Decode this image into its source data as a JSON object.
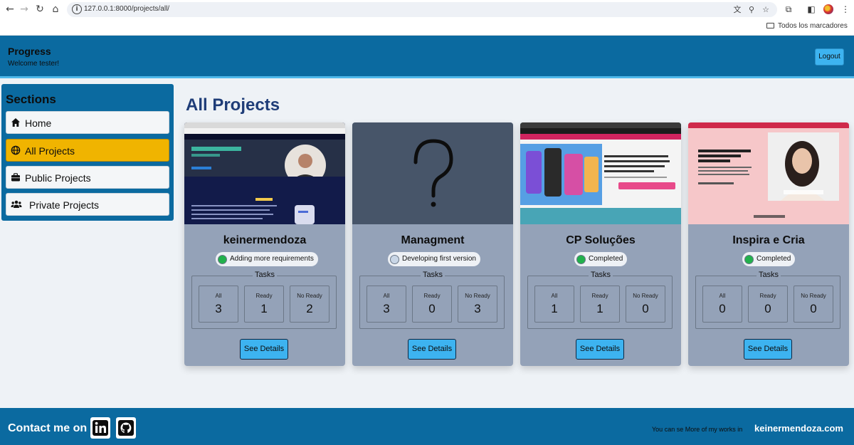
{
  "browser": {
    "url": "127.0.0.1:8000/projects/all/",
    "bookmarks_label": "Todos los marcadores"
  },
  "header": {
    "brand": "Progress",
    "welcome": "Welcome tester!",
    "logout_label": "Logout"
  },
  "sidebar": {
    "title": "Sections",
    "items": [
      {
        "label": "Home",
        "icon": "home-icon",
        "active": false
      },
      {
        "label": "All Projects",
        "icon": "globe-icon",
        "active": true
      },
      {
        "label": "Public Projects",
        "icon": "briefcase-icon",
        "active": false
      },
      {
        "label": "Private Projects",
        "icon": "users-icon",
        "active": false
      }
    ]
  },
  "main": {
    "title": "All Projects",
    "tasks_heading": "Tasks",
    "details_label": "See Details",
    "task_labels": [
      "All",
      "Ready",
      "No Ready"
    ],
    "projects": [
      {
        "name": "keinermendoza",
        "status": "Adding more requirements",
        "status_color": "#22b14c",
        "tasks": {
          "all": "3",
          "ready": "1",
          "no_ready": "2"
        }
      },
      {
        "name": "Managment",
        "status": "Developing first version",
        "status_color": "#c9d6e6",
        "tasks": {
          "all": "3",
          "ready": "0",
          "no_ready": "3"
        }
      },
      {
        "name": "CP Soluções",
        "status": "Completed",
        "status_color": "#22b14c",
        "tasks": {
          "all": "1",
          "ready": "1",
          "no_ready": "0"
        }
      },
      {
        "name": "Inspira e Cria",
        "status": "Completed",
        "status_color": "#22b14c",
        "tasks": {
          "all": "0",
          "ready": "0",
          "no_ready": "0"
        }
      }
    ]
  },
  "footer": {
    "contact": "Contact me on",
    "note": "You can se More of my works in",
    "site": "keinermendoza.com"
  },
  "colors": {
    "brand_blue": "#0b6aa0",
    "accent_cyan": "#3db3f0",
    "active_yellow": "#f0b400",
    "card_bg": "#94a2b8",
    "title_navy": "#1f3d78"
  }
}
